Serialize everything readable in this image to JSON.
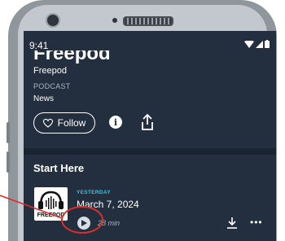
{
  "status_bar": {
    "time": "9:41"
  },
  "show": {
    "title": "Freepod",
    "publisher": "Freepod",
    "type_label": "PODCAST",
    "category": "News"
  },
  "actions": {
    "follow_label": "Follow",
    "info_icon": "info-icon",
    "share_icon": "share-icon"
  },
  "section": {
    "title": "Start Here"
  },
  "episode": {
    "art_text": "FREEPOD",
    "date_label": "YESTERDAY",
    "title": "March 7, 2024",
    "duration": "28 min"
  },
  "colors": {
    "screen_bg": "#232f3e",
    "accent": "#2ec4e6",
    "annotation": "#d9302c"
  }
}
